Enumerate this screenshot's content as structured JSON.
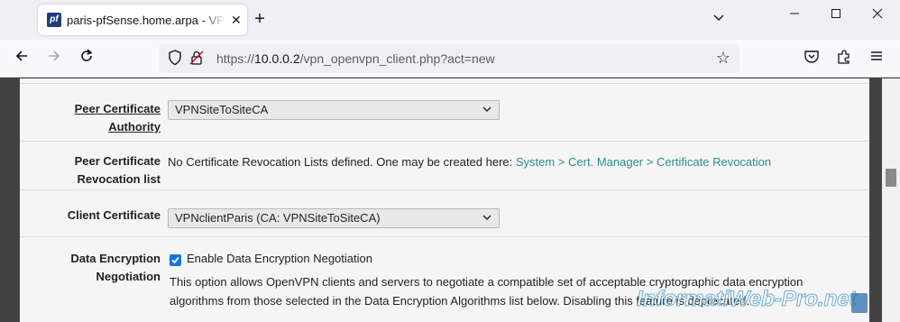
{
  "browser": {
    "tab_title": "paris-pfSense.home.arpa - VPN: OpenVPN",
    "favicon_text": "pf",
    "url_scheme": "https://",
    "url_host": "10.0.0.2",
    "url_path": "/vpn_openvpn_client.php?act=new"
  },
  "form": {
    "peer_ca": {
      "label_line1": "Peer Certificate",
      "label_line2": "Authority",
      "value": "VPNSiteToSiteCA"
    },
    "peer_crl": {
      "label_line1": "Peer Certificate",
      "label_line2": "Revocation list",
      "text": "No Certificate Revocation Lists defined. One may be created here: ",
      "link": "System > Cert. Manager > Certificate Revocation"
    },
    "client_cert": {
      "label": "Client Certificate",
      "value": "VPNclientParis (CA: VPNSiteToSiteCA)"
    },
    "data_encryption": {
      "label_line1": "Data Encryption",
      "label_line2": "Negotiation",
      "checkbox_label": "Enable Data Encryption Negotiation",
      "checked": true,
      "help_line1": "This option allows OpenVPN clients and servers to negotiate a compatible set of acceptable cryptographic data encryption",
      "help_line2": "algorithms from those selected in the Data Encryption Algorithms list below. Disabling this feature is deprecated."
    }
  },
  "watermark": "InformatiWeb-Pro.net",
  "colors": {
    "link": "#2b8d8c",
    "checkbox": "#1a73e8",
    "page_background": "#424242",
    "panel": "#f5f5f5"
  }
}
